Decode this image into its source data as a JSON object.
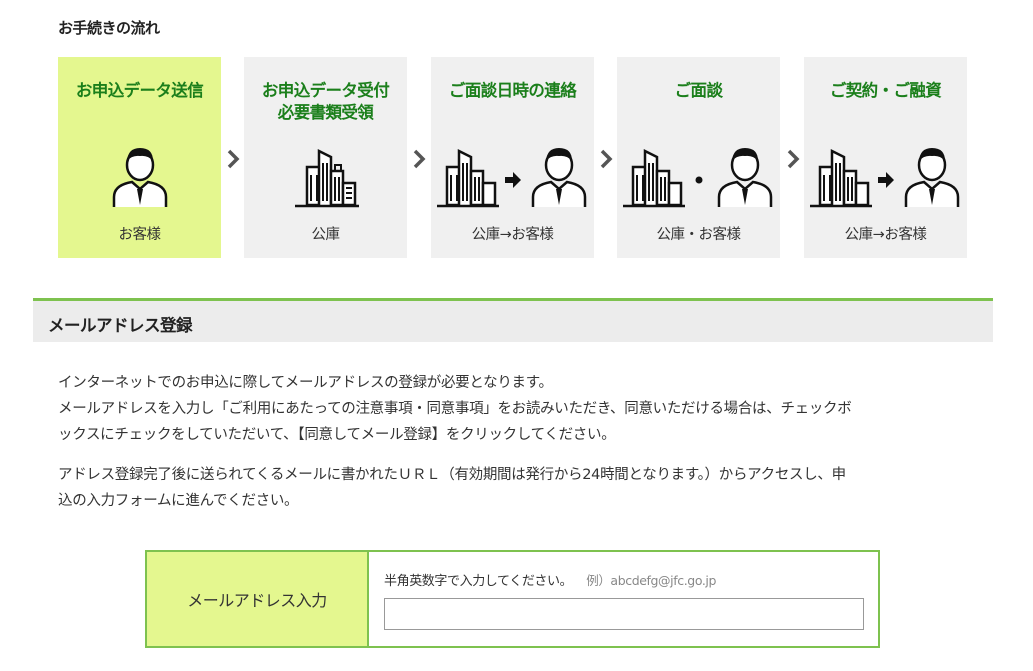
{
  "flow": {
    "heading": "お手続きの流れ",
    "steps": [
      {
        "title": "お申込データ送信",
        "title2": "",
        "label": "お客様",
        "icon": "person-icon",
        "active": true
      },
      {
        "title": "お申込データ受付",
        "title2": "必要書類受領",
        "label": "公庫",
        "icon": "building-icon",
        "active": false
      },
      {
        "title": "ご面談日時の連絡",
        "title2": "",
        "label": "公庫→お客様",
        "icon": "building-to-person-icon",
        "active": false
      },
      {
        "title": "ご面談",
        "title2": "",
        "label": "公庫・お客様",
        "icon": "building-and-person-icon",
        "active": false
      },
      {
        "title": "ご契約・ご融資",
        "title2": "",
        "label": "公庫→お客様",
        "icon": "building-to-person-icon",
        "active": false
      }
    ]
  },
  "section": {
    "title": "メールアドレス登録"
  },
  "body": {
    "p1_line1": "インターネットでのお申込に際してメールアドレスの登録が必要となります。",
    "p1_line2": "メールアドレスを入力し「ご利用にあたっての注意事項・同意事項」をお読みいただき、同意いただける場合は、チェックボ",
    "p1_line3": "ックスにチェックをしていただいて、【同意してメール登録】をクリックしてください。",
    "p2_line1": "アドレス登録完了後に送られてくるメールに書かれたＵＲＬ（有効期間は発行から24時間となります。）からアクセスし、申",
    "p2_line2": "込の入力フォームに進んでください。"
  },
  "form": {
    "label": "メールアドレス入力",
    "hint": "半角英数字で入力してください。",
    "example": "例）abcdefg@jfc.go.jp",
    "value": "",
    "placeholder": ""
  },
  "colors": {
    "accent_green": "#7ec24f",
    "title_green": "#1b7f1b",
    "highlight": "#e4f78f"
  }
}
